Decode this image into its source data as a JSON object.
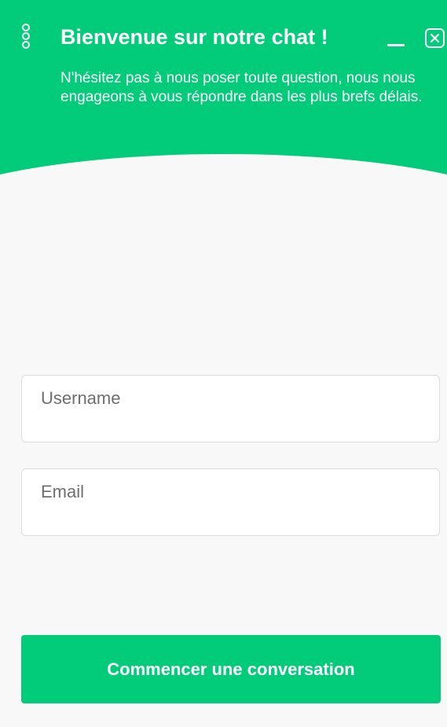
{
  "header": {
    "title": "Bienvenue sur notre chat !",
    "subtitle": "N'hésitez pas à nous poser toute question, nous nous engageons à vous répondre dans les plus brefs délais.",
    "menu_icon": "vertical-dots-icon",
    "minimize_icon": "minimize-icon",
    "close_icon": "close-icon"
  },
  "form": {
    "username_placeholder": "Username",
    "email_placeholder": "Email",
    "submit_label": "Commencer une conversation"
  },
  "colors": {
    "brand_green": "#02cc7a",
    "background": "#f8f8f8",
    "text_on_brand": "#ffffff"
  }
}
